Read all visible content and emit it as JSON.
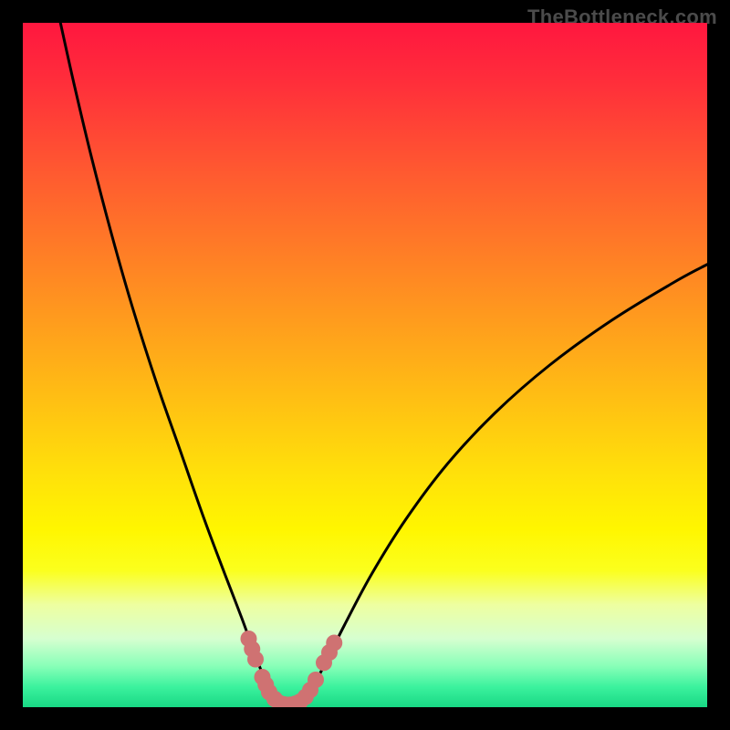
{
  "watermark": "TheBottleneck.com",
  "colors": {
    "frame": "#000000",
    "curve": "#000000",
    "marker": "#cf7272"
  },
  "chart_data": {
    "type": "line",
    "title": "",
    "xlabel": "",
    "ylabel": "",
    "xlim": [
      0,
      100
    ],
    "ylim": [
      0,
      100
    ],
    "background_gradient_stops": [
      {
        "offset": 0.0,
        "color": "#ff173f"
      },
      {
        "offset": 0.08,
        "color": "#ff2c3b"
      },
      {
        "offset": 0.22,
        "color": "#ff5a30"
      },
      {
        "offset": 0.38,
        "color": "#ff8b22"
      },
      {
        "offset": 0.53,
        "color": "#ffb915"
      },
      {
        "offset": 0.66,
        "color": "#ffe10a"
      },
      {
        "offset": 0.74,
        "color": "#fff600"
      },
      {
        "offset": 0.8,
        "color": "#fbff1d"
      },
      {
        "offset": 0.85,
        "color": "#eeffa0"
      },
      {
        "offset": 0.9,
        "color": "#d6ffd0"
      },
      {
        "offset": 0.94,
        "color": "#88ffb8"
      },
      {
        "offset": 0.97,
        "color": "#3cf29e"
      },
      {
        "offset": 1.0,
        "color": "#18d884"
      }
    ],
    "series": [
      {
        "name": "left-curve",
        "points": [
          {
            "x": 5.5,
            "y": 100.0
          },
          {
            "x": 7.5,
            "y": 91.0
          },
          {
            "x": 10.0,
            "y": 80.5
          },
          {
            "x": 13.0,
            "y": 69.0
          },
          {
            "x": 16.0,
            "y": 58.5
          },
          {
            "x": 19.5,
            "y": 47.5
          },
          {
            "x": 23.0,
            "y": 37.5
          },
          {
            "x": 26.5,
            "y": 27.5
          },
          {
            "x": 29.5,
            "y": 19.5
          },
          {
            "x": 32.0,
            "y": 13.0
          },
          {
            "x": 34.0,
            "y": 7.5
          },
          {
            "x": 35.5,
            "y": 3.7
          },
          {
            "x": 36.5,
            "y": 1.7
          },
          {
            "x": 37.5,
            "y": 0.7
          },
          {
            "x": 38.7,
            "y": 0.4
          }
        ]
      },
      {
        "name": "right-curve",
        "points": [
          {
            "x": 38.7,
            "y": 0.4
          },
          {
            "x": 40.0,
            "y": 0.5
          },
          {
            "x": 41.2,
            "y": 1.3
          },
          {
            "x": 42.5,
            "y": 3.2
          },
          {
            "x": 44.5,
            "y": 7.0
          },
          {
            "x": 47.0,
            "y": 12.0
          },
          {
            "x": 51.0,
            "y": 19.5
          },
          {
            "x": 56.0,
            "y": 27.5
          },
          {
            "x": 62.0,
            "y": 35.5
          },
          {
            "x": 69.0,
            "y": 43.0
          },
          {
            "x": 77.0,
            "y": 50.0
          },
          {
            "x": 86.0,
            "y": 56.5
          },
          {
            "x": 95.0,
            "y": 62.0
          },
          {
            "x": 100.0,
            "y": 64.7
          }
        ]
      },
      {
        "name": "valley-markers",
        "points": [
          {
            "x": 33.0,
            "y": 10.0
          },
          {
            "x": 33.5,
            "y": 8.5
          },
          {
            "x": 34.0,
            "y": 7.0
          },
          {
            "x": 35.0,
            "y": 4.4
          },
          {
            "x": 35.5,
            "y": 3.3
          },
          {
            "x": 36.0,
            "y": 2.2
          },
          {
            "x": 36.8,
            "y": 1.2
          },
          {
            "x": 37.5,
            "y": 0.6
          },
          {
            "x": 38.2,
            "y": 0.4
          },
          {
            "x": 39.0,
            "y": 0.35
          },
          {
            "x": 39.8,
            "y": 0.5
          },
          {
            "x": 40.5,
            "y": 0.8
          },
          {
            "x": 41.3,
            "y": 1.5
          },
          {
            "x": 42.0,
            "y": 2.5
          },
          {
            "x": 42.8,
            "y": 4.0
          },
          {
            "x": 44.0,
            "y": 6.5
          },
          {
            "x": 44.8,
            "y": 8.0
          },
          {
            "x": 45.5,
            "y": 9.4
          }
        ]
      }
    ]
  }
}
